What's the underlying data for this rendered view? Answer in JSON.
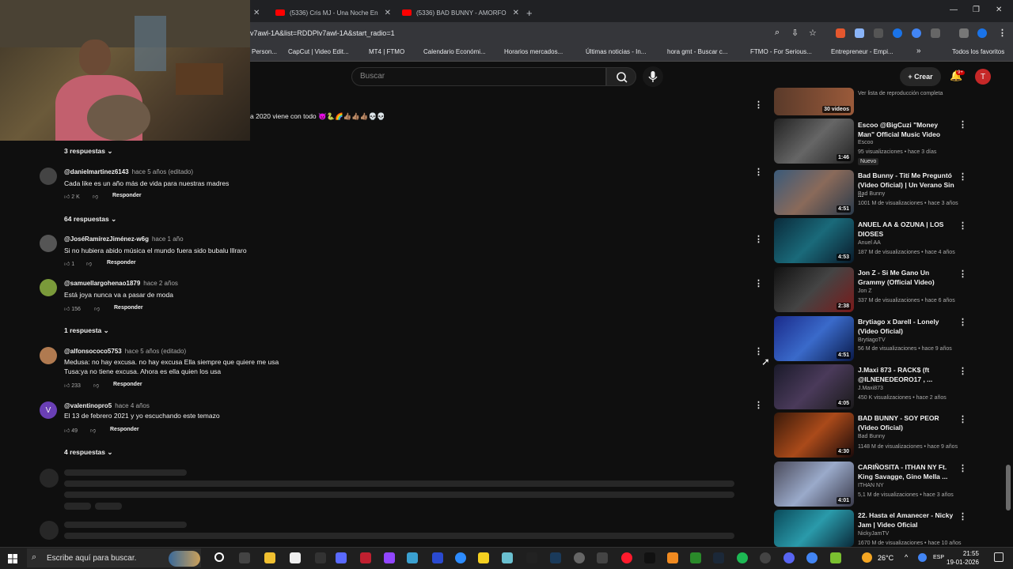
{
  "tabs": [
    {
      "label": "(5336) Cris MJ - Una Noche En"
    },
    {
      "label": "(5336) BAD BUNNY - AMORFO"
    }
  ],
  "new_tab": "+",
  "window_controls": {
    "min": "—",
    "restore": "❐",
    "close": "✕"
  },
  "address": {
    "url": "v7awl-1A&list=RDDPlv7awl-1A&start_radio=1"
  },
  "bookmarks": [
    {
      "label": "Person..."
    },
    {
      "label": "CapCut | Video Edit..."
    },
    {
      "label": "MT4 | FTMO"
    },
    {
      "label": "Calendario Económi..."
    },
    {
      "label": "Horarios mercados..."
    },
    {
      "label": "Últimas noticias - In..."
    },
    {
      "label": "hora gmt - Buscar c..."
    },
    {
      "label": "FTMO - For Serious..."
    },
    {
      "label": "Entrepreneur - Empi..."
    },
    {
      "label": "»"
    },
    {
      "label": "Todos los favoritos"
    }
  ],
  "header": {
    "search_placeholder": "Buscar",
    "create_label": "+ Crear",
    "notif_count": "9+",
    "avatar_letter": "T"
  },
  "top_comment_tail": "a 2020 viene con todo 😈🐍🌈👍🏽👍🏽👍🏽💀💀",
  "comments": [
    {
      "replies": "3 respuestas"
    },
    {
      "user": "@danielmartinez6143",
      "ago": "hace 5 años (editado)",
      "text": [
        "Cada like es un año más de vida para nuestras madres"
      ],
      "likes": "2 K",
      "reply": "Responder",
      "replies": "64 respuestas"
    },
    {
      "user": "@JoséRamírezJiménez-w6g",
      "ago": "hace 1 año",
      "text": [
        "Si no hubiera abido música el mundo fuera sido bubalu lllraro"
      ],
      "likes": "1",
      "reply": "Responder"
    },
    {
      "user": "@samuellargohenao1879",
      "ago": "hace 2 años",
      "text": [
        "Está joya nunca va a pasar de moda"
      ],
      "likes": "156",
      "reply": "Responder",
      "replies": "1 respuesta"
    },
    {
      "user": "@alfonsococo5753",
      "ago": "hace 5 años (editado)",
      "text": [
        "Medusa: no hay excusa. no hay excusa Ella siempre que quiere me usa",
        "Tusa:ya no tiene excusa. Ahora es ella quien los usa"
      ],
      "likes": "233",
      "reply": "Responder"
    },
    {
      "user": "@valentinopro5",
      "ago": "hace 4 años",
      "avatar_letter": "V",
      "text": [
        "El 13 de febrero 2021 y yo escuchando este temazo"
      ],
      "likes": "49",
      "reply": "Responder",
      "replies": "4 respuestas"
    }
  ],
  "sidebar": {
    "playlist_count": "30 videos",
    "playlist_link": "Ver lista de reproducción completa",
    "videos": [
      {
        "title": "Escoo @BigCuzi \"Money Man\" Official Music Video",
        "channel": "Escoo",
        "meta": "95 visualizaciones • hace 3 días",
        "badge": "Nuevo",
        "duration": "1:46"
      },
      {
        "title": "Bad Bunny - Tití Me Preguntó (Video Oficial) | Un Verano Sin ...",
        "channel": "Bad Bunny",
        "meta": "1001 M de visualizaciones • hace 3 años",
        "duration": "4:51"
      },
      {
        "title": "ANUEL AA & OZUNA | LOS DIOSES",
        "channel": "Anuel AA",
        "meta": "187 M de visualizaciones • hace 4 años",
        "duration": "4:53"
      },
      {
        "title": "Jon Z - Si Me Gano Un Grammy (Official Video)",
        "channel": "Jon Z",
        "meta": "337 M de visualizaciones • hace 6 años",
        "duration": "2:38"
      },
      {
        "title": "Brytiago x Darell - Lonely (Video Oficial)",
        "channel": "BrytiagoTV",
        "meta": "56 M de visualizaciones • hace 9 años",
        "duration": "4:51"
      },
      {
        "title": "J.Maxi 873 - RACK$ (ft @ILNENEDEORO17 , ...",
        "channel": "J.Maxi873",
        "meta": "450 K visualizaciones • hace 2 años",
        "duration": "4:05"
      },
      {
        "title": "BAD BUNNY - SOY PEOR (Video Oficial)",
        "channel": "Bad Bunny",
        "meta": "1148 M de visualizaciones • hace 9 años",
        "duration": "4:30"
      },
      {
        "title": "CARIÑOSITA - ITHAN NY Ft. King Savagge, Gino Mella ...",
        "channel": "ITHAN NY",
        "meta": "5,1 M de visualizaciones • hace 3 años",
        "duration": "4:01"
      },
      {
        "title": "22. Hasta el Amanecer - Nicky Jam | Video Oficial",
        "channel": "NickyJamTV",
        "meta": "1670 M de visualizaciones • hace 10 años",
        "duration": ""
      }
    ]
  },
  "taskbar": {
    "search_placeholder": "Escribe aquí para buscar.",
    "temperature": "26°C",
    "language": "ESP",
    "time": "21:55",
    "date": "19-01-2026"
  },
  "colors": {
    "bg": "#0f0f0f",
    "accent": "#ff0000",
    "text": "#f1f1f1",
    "muted": "#aaaaaa"
  }
}
